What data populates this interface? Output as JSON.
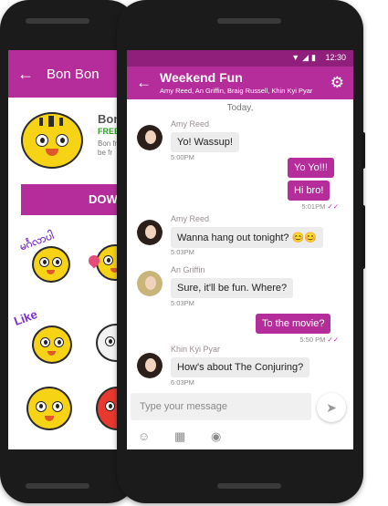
{
  "back_phone": {
    "title": "Bon Bon",
    "back_icon": "arrow-left-icon",
    "sticker_pack": {
      "name": "Bon",
      "price": "FREE",
      "description": "Bon friend be fr",
      "download_label": "DOW",
      "sticker_captions": [
        "မင်္ဂလာပါ",
        "Like"
      ]
    },
    "accent": "#b42d9b"
  },
  "front_phone": {
    "status": {
      "time": "12:30",
      "icons": [
        "wifi-icon",
        "signal-icon",
        "battery-icon"
      ]
    },
    "header": {
      "title": "Weekend Fun",
      "members": "Amy Reed, An Griffin, Braig Russell, Khin Kyi Pyar",
      "back_icon": "arrow-left-icon",
      "settings_icon": "gear-icon"
    },
    "day_label": "Today,",
    "messages": [
      {
        "sender": "Amy Reed",
        "text": "Yo! Wassup!",
        "time": "5:00PM",
        "direction": "in"
      },
      {
        "text": "Yo Yo!!!",
        "direction": "out"
      },
      {
        "text": "Hi bro!",
        "time": "5:01PM",
        "direction": "out"
      },
      {
        "sender": "Amy Reed",
        "text": "Wanna hang out tonight? 😊😊",
        "time": "5:03PM",
        "direction": "in"
      },
      {
        "sender": "An Griffin",
        "text": "Sure, it'll be fun. Where?",
        "time": "5:03PM",
        "direction": "in"
      },
      {
        "text": "To the movie?",
        "time": "5:50 PM",
        "direction": "out"
      },
      {
        "sender": "Khin Kyi Pyar",
        "text": "How's about The Conjuring?",
        "time": "6:03PM",
        "direction": "in"
      }
    ],
    "composer": {
      "placeholder": "Type your message",
      "send_icon": "send-icon",
      "tools": [
        "sticker-icon",
        "image-icon",
        "camera-icon"
      ]
    },
    "colors": {
      "accent": "#b42d9b",
      "statusbar": "#8f1f7b",
      "incoming_bubble": "#ececec"
    }
  }
}
